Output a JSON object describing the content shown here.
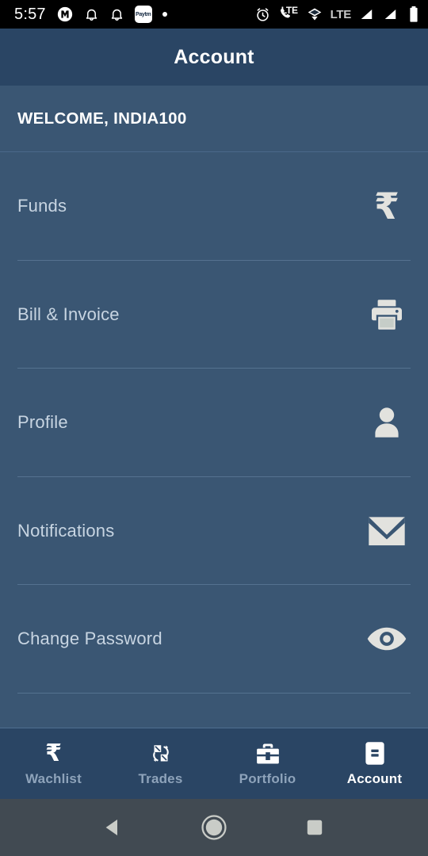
{
  "status_bar": {
    "time": "5:57",
    "left_icons": [
      {
        "name": "app-m-icon",
        "label": "M"
      },
      {
        "name": "bell-icon",
        "label": "bell"
      },
      {
        "name": "bell-icon-2",
        "label": "bell"
      },
      {
        "name": "paytm-icon",
        "label": "Paytm"
      },
      {
        "name": "dot-icon",
        "label": "dot"
      }
    ],
    "paytm_label": "Paytm",
    "right_icons": [
      {
        "name": "alarm-icon",
        "label": "alarm"
      },
      {
        "name": "call-lte-icon",
        "label": "LTE"
      },
      {
        "name": "vpn-icon",
        "label": "vpn"
      },
      {
        "name": "signal-bar-1",
        "label": "signal"
      },
      {
        "name": "signal-bar-2",
        "label": "signal"
      },
      {
        "name": "battery-icon",
        "label": "battery"
      }
    ],
    "lte_label": "LTE",
    "call_lte_label": "LTE"
  },
  "header": {
    "title": "Account"
  },
  "welcome": {
    "text": "WELCOME, INDIA100"
  },
  "menu": {
    "items": [
      {
        "label": "Funds",
        "icon": "rupee-icon"
      },
      {
        "label": "Bill & Invoice",
        "icon": "printer-icon"
      },
      {
        "label": "Profile",
        "icon": "person-icon"
      },
      {
        "label": "Notifications",
        "icon": "envelope-icon"
      },
      {
        "label": "Change Password",
        "icon": "eye-icon"
      }
    ]
  },
  "bottom_nav": {
    "items": [
      {
        "label": "Wachlist",
        "icon": "rupee-icon",
        "active": false
      },
      {
        "label": "Trades",
        "icon": "exchange-icon",
        "active": false
      },
      {
        "label": "Portfolio",
        "icon": "briefcase-icon",
        "active": false
      },
      {
        "label": "Account",
        "icon": "id-card-icon",
        "active": true
      }
    ]
  },
  "system_nav": {
    "back_label": "Back",
    "home_label": "Home",
    "recents_label": "Recents"
  },
  "colors": {
    "background": "#3a5673",
    "header": "#2a4564",
    "status_bar": "#000000",
    "system_nav": "#414a52",
    "accent_text": "#ffffff",
    "muted_text": "#c8d5e2",
    "nav_inactive": "#8ea3ba",
    "icon": "#e2e2de",
    "divider": "#6c8aa8"
  }
}
